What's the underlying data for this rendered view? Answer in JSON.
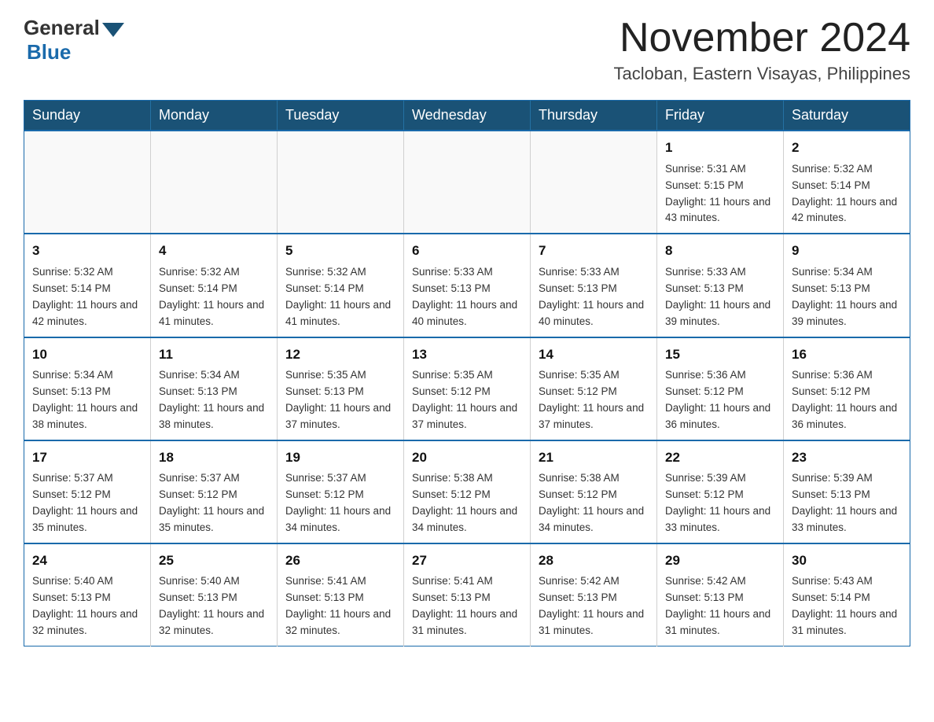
{
  "logo": {
    "general": "General",
    "blue": "Blue"
  },
  "title": "November 2024",
  "location": "Tacloban, Eastern Visayas, Philippines",
  "days_header": [
    "Sunday",
    "Monday",
    "Tuesday",
    "Wednesday",
    "Thursday",
    "Friday",
    "Saturday"
  ],
  "weeks": [
    [
      {
        "day": "",
        "info": ""
      },
      {
        "day": "",
        "info": ""
      },
      {
        "day": "",
        "info": ""
      },
      {
        "day": "",
        "info": ""
      },
      {
        "day": "",
        "info": ""
      },
      {
        "day": "1",
        "info": "Sunrise: 5:31 AM\nSunset: 5:15 PM\nDaylight: 11 hours and 43 minutes."
      },
      {
        "day": "2",
        "info": "Sunrise: 5:32 AM\nSunset: 5:14 PM\nDaylight: 11 hours and 42 minutes."
      }
    ],
    [
      {
        "day": "3",
        "info": "Sunrise: 5:32 AM\nSunset: 5:14 PM\nDaylight: 11 hours and 42 minutes."
      },
      {
        "day": "4",
        "info": "Sunrise: 5:32 AM\nSunset: 5:14 PM\nDaylight: 11 hours and 41 minutes."
      },
      {
        "day": "5",
        "info": "Sunrise: 5:32 AM\nSunset: 5:14 PM\nDaylight: 11 hours and 41 minutes."
      },
      {
        "day": "6",
        "info": "Sunrise: 5:33 AM\nSunset: 5:13 PM\nDaylight: 11 hours and 40 minutes."
      },
      {
        "day": "7",
        "info": "Sunrise: 5:33 AM\nSunset: 5:13 PM\nDaylight: 11 hours and 40 minutes."
      },
      {
        "day": "8",
        "info": "Sunrise: 5:33 AM\nSunset: 5:13 PM\nDaylight: 11 hours and 39 minutes."
      },
      {
        "day": "9",
        "info": "Sunrise: 5:34 AM\nSunset: 5:13 PM\nDaylight: 11 hours and 39 minutes."
      }
    ],
    [
      {
        "day": "10",
        "info": "Sunrise: 5:34 AM\nSunset: 5:13 PM\nDaylight: 11 hours and 38 minutes."
      },
      {
        "day": "11",
        "info": "Sunrise: 5:34 AM\nSunset: 5:13 PM\nDaylight: 11 hours and 38 minutes."
      },
      {
        "day": "12",
        "info": "Sunrise: 5:35 AM\nSunset: 5:13 PM\nDaylight: 11 hours and 37 minutes."
      },
      {
        "day": "13",
        "info": "Sunrise: 5:35 AM\nSunset: 5:12 PM\nDaylight: 11 hours and 37 minutes."
      },
      {
        "day": "14",
        "info": "Sunrise: 5:35 AM\nSunset: 5:12 PM\nDaylight: 11 hours and 37 minutes."
      },
      {
        "day": "15",
        "info": "Sunrise: 5:36 AM\nSunset: 5:12 PM\nDaylight: 11 hours and 36 minutes."
      },
      {
        "day": "16",
        "info": "Sunrise: 5:36 AM\nSunset: 5:12 PM\nDaylight: 11 hours and 36 minutes."
      }
    ],
    [
      {
        "day": "17",
        "info": "Sunrise: 5:37 AM\nSunset: 5:12 PM\nDaylight: 11 hours and 35 minutes."
      },
      {
        "day": "18",
        "info": "Sunrise: 5:37 AM\nSunset: 5:12 PM\nDaylight: 11 hours and 35 minutes."
      },
      {
        "day": "19",
        "info": "Sunrise: 5:37 AM\nSunset: 5:12 PM\nDaylight: 11 hours and 34 minutes."
      },
      {
        "day": "20",
        "info": "Sunrise: 5:38 AM\nSunset: 5:12 PM\nDaylight: 11 hours and 34 minutes."
      },
      {
        "day": "21",
        "info": "Sunrise: 5:38 AM\nSunset: 5:12 PM\nDaylight: 11 hours and 34 minutes."
      },
      {
        "day": "22",
        "info": "Sunrise: 5:39 AM\nSunset: 5:12 PM\nDaylight: 11 hours and 33 minutes."
      },
      {
        "day": "23",
        "info": "Sunrise: 5:39 AM\nSunset: 5:13 PM\nDaylight: 11 hours and 33 minutes."
      }
    ],
    [
      {
        "day": "24",
        "info": "Sunrise: 5:40 AM\nSunset: 5:13 PM\nDaylight: 11 hours and 32 minutes."
      },
      {
        "day": "25",
        "info": "Sunrise: 5:40 AM\nSunset: 5:13 PM\nDaylight: 11 hours and 32 minutes."
      },
      {
        "day": "26",
        "info": "Sunrise: 5:41 AM\nSunset: 5:13 PM\nDaylight: 11 hours and 32 minutes."
      },
      {
        "day": "27",
        "info": "Sunrise: 5:41 AM\nSunset: 5:13 PM\nDaylight: 11 hours and 31 minutes."
      },
      {
        "day": "28",
        "info": "Sunrise: 5:42 AM\nSunset: 5:13 PM\nDaylight: 11 hours and 31 minutes."
      },
      {
        "day": "29",
        "info": "Sunrise: 5:42 AM\nSunset: 5:13 PM\nDaylight: 11 hours and 31 minutes."
      },
      {
        "day": "30",
        "info": "Sunrise: 5:43 AM\nSunset: 5:14 PM\nDaylight: 11 hours and 31 minutes."
      }
    ]
  ]
}
